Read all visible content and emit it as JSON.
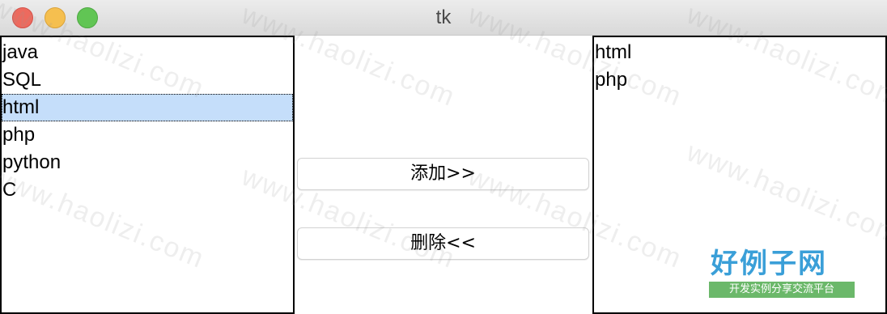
{
  "window": {
    "title": "tk"
  },
  "left_list": {
    "items": [
      "java",
      "SQL",
      "html",
      "php",
      "python",
      "C"
    ],
    "selected": "html"
  },
  "buttons": {
    "add_label": "添加>>",
    "delete_label": "删除<<"
  },
  "right_list": {
    "items": [
      "html",
      "php"
    ]
  },
  "watermark": {
    "text": "www.haolizi.com"
  },
  "logo": {
    "main": "好例子网",
    "sub": "开发实例分享交流平台"
  },
  "colors": {
    "selection": "#c5defa",
    "close_button": "#ed6a5e",
    "minimize_button": "#f5bf4f",
    "maximize_button": "#61c554",
    "logo_blue": "#3a9fd8",
    "logo_green": "#6bb86a"
  }
}
